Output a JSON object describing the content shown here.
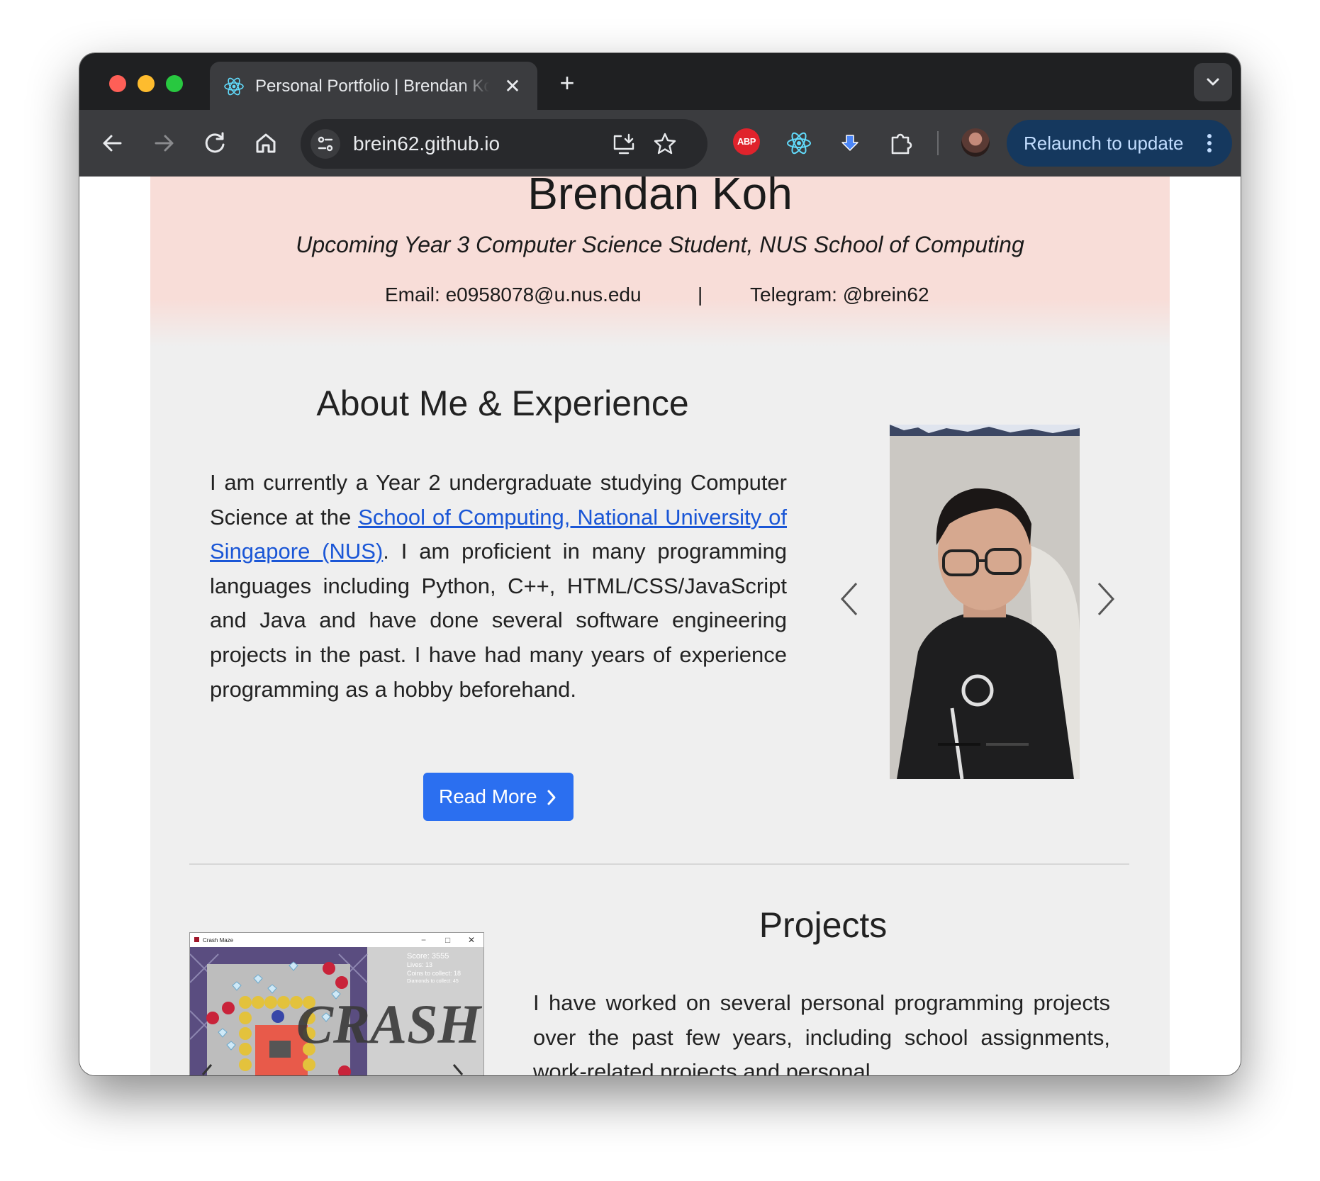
{
  "browser": {
    "tab_title": "Personal Portfolio | Brendan Koh",
    "tab_close": "✕",
    "new_tab": "+",
    "url": "brein62.github.io",
    "relaunch_label": "Relaunch to update",
    "abp_label": "ABP"
  },
  "hero": {
    "name": "Brendan Koh",
    "subtitle": "Upcoming Year 3 Computer Science Student, NUS School of Computing",
    "email": "Email: e0958078@u.nus.edu",
    "separator": "|",
    "telegram": "Telegram: @brein62"
  },
  "about": {
    "title": "About Me & Experience",
    "text_before_link": "I am currently a Year 2 undergraduate studying Computer Science at the ",
    "link_text": "School of Computing, National University of Singapore (NUS)",
    "text_after_link": ". I am proficient in many programming languages including Python, C++, HTML/CSS/JavaScript and Java and have done several software engineering projects in the past. I have had many years of experience programming as a hobby beforehand.",
    "read_more_label": "Read More"
  },
  "projects": {
    "title": "Projects",
    "text": "I have worked on several personal programming projects over the past few years, including school assignments, work-related projects and personal",
    "screenshot": {
      "window_title": "Crash Maze",
      "score": "Score: 3555",
      "lives": "Lives: 13",
      "coins": "Coins to collect: 18",
      "diamonds": "Diamonds to collect: 45"
    }
  },
  "colors": {
    "hero_bg": "#f8ddd8",
    "page_bg": "#efefef",
    "link": "#1a56d6",
    "button": "#2b6ff0",
    "relaunch_bg": "#15385e"
  },
  "icons": [
    "react-favicon-icon",
    "back-arrow-icon",
    "forward-arrow-icon",
    "reload-icon",
    "home-icon",
    "site-info-icon",
    "install-app-icon",
    "bookmark-star-icon",
    "adblock-icon",
    "react-devtools-icon",
    "download-extension-icon",
    "extensions-puzzle-icon",
    "profile-avatar",
    "kebab-menu-icon",
    "chevron-right-icon",
    "carousel-prev-icon",
    "carousel-next-icon"
  ]
}
